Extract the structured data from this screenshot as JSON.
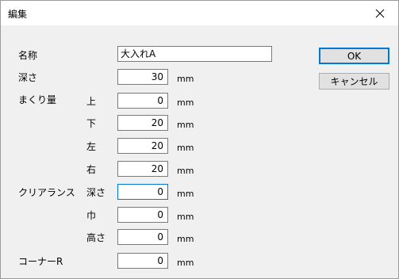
{
  "window": {
    "title": "編集"
  },
  "fields": {
    "name": {
      "label": "名称",
      "value": "大入れA"
    },
    "depth": {
      "label": "深さ",
      "value": "30",
      "unit": "mm"
    },
    "flip_amount": {
      "label": "まくり量",
      "top": {
        "label": "上",
        "value": "0",
        "unit": "mm"
      },
      "bottom": {
        "label": "下",
        "value": "20",
        "unit": "mm"
      },
      "left": {
        "label": "左",
        "value": "20",
        "unit": "mm"
      },
      "right": {
        "label": "右",
        "value": "20",
        "unit": "mm"
      }
    },
    "clearance": {
      "label": "クリアランス",
      "depth": {
        "label": "深さ",
        "value": "0",
        "unit": "mm"
      },
      "width": {
        "label": "巾",
        "value": "0",
        "unit": "mm"
      },
      "height": {
        "label": "高さ",
        "value": "0",
        "unit": "mm"
      }
    },
    "corner_r": {
      "label": "コーナーR",
      "value": "0",
      "unit": "mm"
    }
  },
  "buttons": {
    "ok": "OK",
    "cancel": "キャンセル"
  }
}
